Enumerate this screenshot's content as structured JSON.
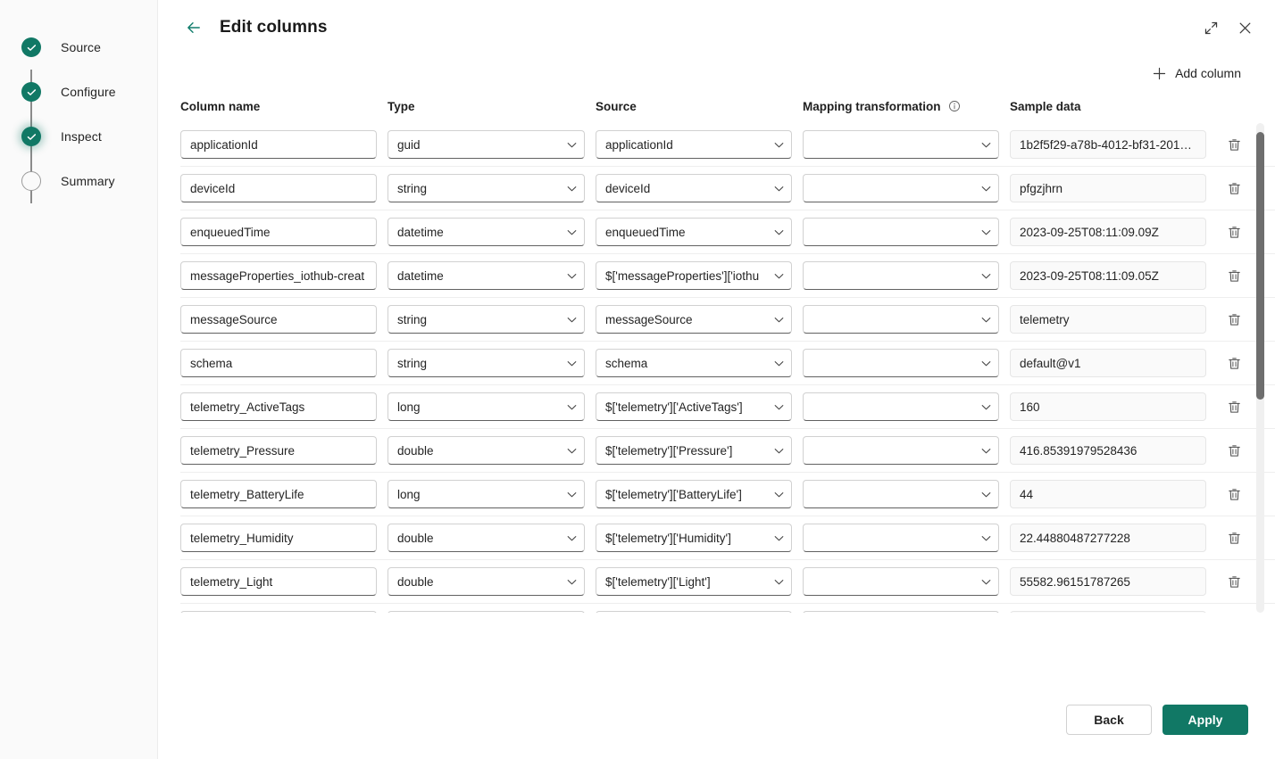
{
  "sidebar": {
    "steps": [
      {
        "label": "Source",
        "state": "done"
      },
      {
        "label": "Configure",
        "state": "done"
      },
      {
        "label": "Inspect",
        "state": "done-focus"
      },
      {
        "label": "Summary",
        "state": "todo"
      }
    ]
  },
  "header": {
    "title": "Edit columns",
    "back_icon": "arrow-left-icon",
    "expand_icon": "expand-diagonal-icon",
    "close_icon": "close-icon"
  },
  "toolbar": {
    "add_column_label": "Add column",
    "add_icon": "plus-icon"
  },
  "table": {
    "headers": {
      "column_name": "Column name",
      "type": "Type",
      "source": "Source",
      "mapping_transformation": "Mapping transformation",
      "sample_data": "Sample data",
      "info_icon": "info-icon"
    },
    "delete_icon": "trash-icon",
    "chevron_icon": "chevron-down-icon",
    "rows": [
      {
        "name": "applicationId",
        "type": "guid",
        "source": "applicationId",
        "mapping": "",
        "sample": "1b2f5f29-a78b-4012-bf31-201…"
      },
      {
        "name": "deviceId",
        "type": "string",
        "source": "deviceId",
        "mapping": "",
        "sample": "pfgzjhrn"
      },
      {
        "name": "enqueuedTime",
        "type": "datetime",
        "source": "enqueuedTime",
        "mapping": "",
        "sample": "2023-09-25T08:11:09.09Z"
      },
      {
        "name": "messageProperties_iothub-creat",
        "type": "datetime",
        "source": "$['messageProperties']['iothu",
        "mapping": "",
        "sample": "2023-09-25T08:11:09.05Z"
      },
      {
        "name": "messageSource",
        "type": "string",
        "source": "messageSource",
        "mapping": "",
        "sample": "telemetry"
      },
      {
        "name": "schema",
        "type": "string",
        "source": "schema",
        "mapping": "",
        "sample": "default@v1"
      },
      {
        "name": "telemetry_ActiveTags",
        "type": "long",
        "source": "$['telemetry']['ActiveTags']",
        "mapping": "",
        "sample": "160"
      },
      {
        "name": "telemetry_Pressure",
        "type": "double",
        "source": "$['telemetry']['Pressure']",
        "mapping": "",
        "sample": "416.85391979528436"
      },
      {
        "name": "telemetry_BatteryLife",
        "type": "long",
        "source": "$['telemetry']['BatteryLife']",
        "mapping": "",
        "sample": "44"
      },
      {
        "name": "telemetry_Humidity",
        "type": "double",
        "source": "$['telemetry']['Humidity']",
        "mapping": "",
        "sample": "22.44880487277228"
      },
      {
        "name": "telemetry_Light",
        "type": "double",
        "source": "$['telemetry']['Light']",
        "mapping": "",
        "sample": "55582.96151787265"
      },
      {
        "name": "",
        "type": "",
        "source": "",
        "mapping": "",
        "sample": ""
      }
    ]
  },
  "footer": {
    "back_label": "Back",
    "apply_label": "Apply"
  },
  "colors": {
    "accent": "#117865",
    "step_done": "#117865",
    "text": "#242424",
    "input_border": "#d1d1d1",
    "input_border_bottom": "#616161",
    "panel_bg": "#ffffff",
    "sidebar_bg": "#fafafa"
  }
}
